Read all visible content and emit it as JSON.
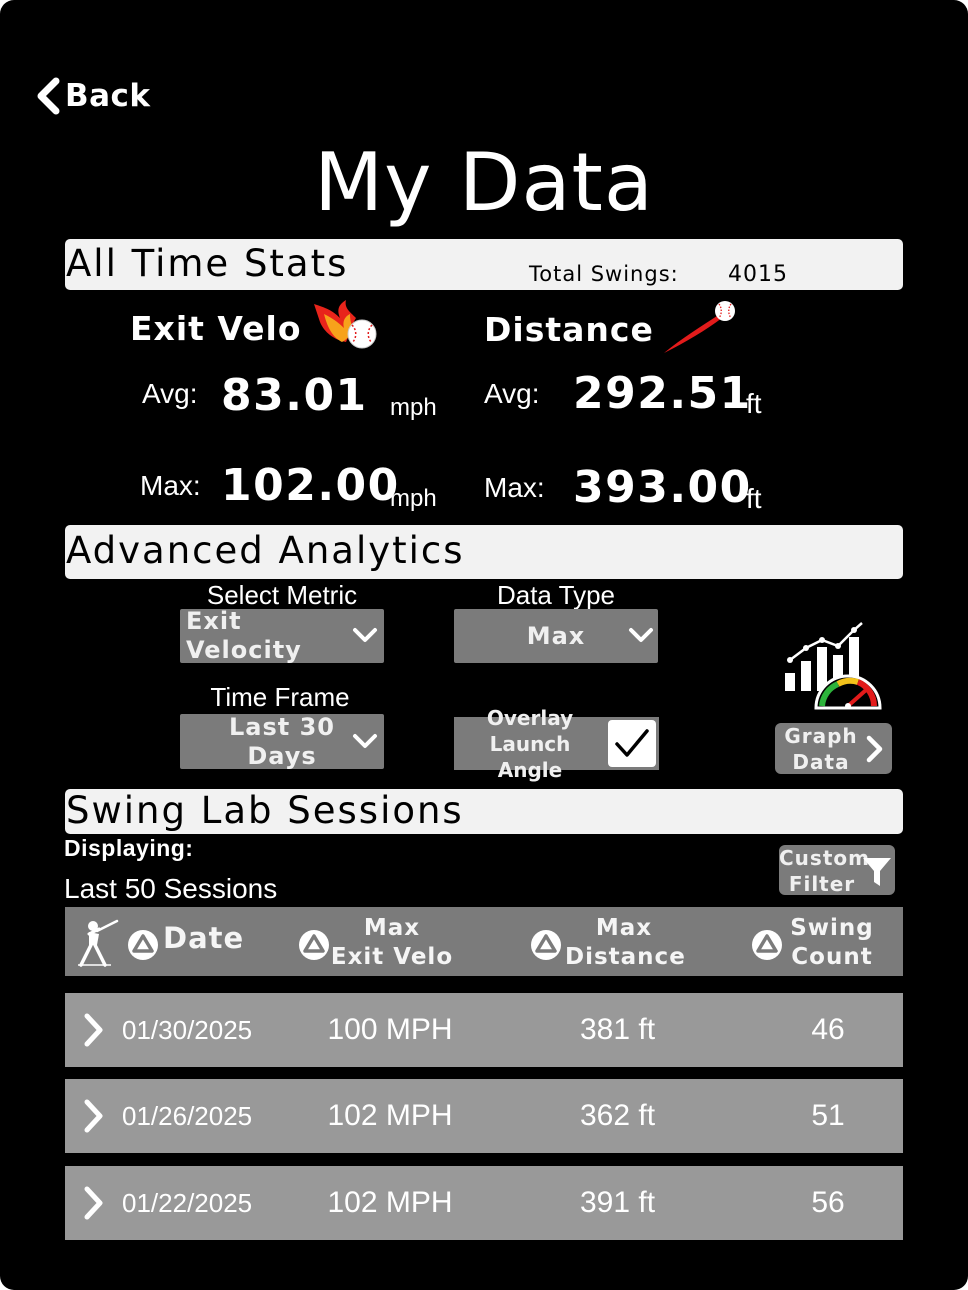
{
  "nav": {
    "back_label": "Back"
  },
  "page": {
    "title": "My Data"
  },
  "all_time": {
    "section_title": "All Time Stats",
    "total_swings_label": "Total Swings:",
    "total_swings_value": "4015",
    "exit_velo": {
      "title": "Exit Velo",
      "avg_label": "Avg:",
      "avg_value": "83.01",
      "max_label": "Max:",
      "max_value": "102.00",
      "unit": "mph",
      "icon": "flaming-baseball-icon"
    },
    "distance": {
      "title": "Distance",
      "avg_label": "Avg:",
      "avg_value": "292.51",
      "max_label": "Max:",
      "max_value": "393.00",
      "unit": "ft",
      "icon": "baseball-trajectory-icon"
    }
  },
  "analytics": {
    "section_title": "Advanced Analytics",
    "metric": {
      "label": "Select Metric",
      "value": "Exit Velocity"
    },
    "data_type": {
      "label": "Data Type",
      "value": "Max"
    },
    "time_frame": {
      "label": "Time Frame",
      "value_line1": "Last 30",
      "value_line2": "Days"
    },
    "overlay": {
      "line1": "Overlay",
      "line2": "Launch Angle",
      "checked": true
    },
    "graph_button": {
      "line1": "Graph",
      "line2": "Data"
    },
    "graph_icon": "chart-gauge-icon"
  },
  "sessions": {
    "section_title": "Swing Lab Sessions",
    "displaying_label": "Displaying:",
    "displaying_value": "Last 50 Sessions",
    "filter_button": {
      "line1": "Custom",
      "line2": "Filter"
    },
    "columns": {
      "date": "Date",
      "velo_line1": "Max",
      "velo_line2": "Exit Velo",
      "dist_line1": "Max",
      "dist_line2": "Distance",
      "count_line1": "Swing",
      "count_line2": "Count"
    },
    "rows": [
      {
        "date": "01/30/2025",
        "velo": "100 MPH",
        "dist": "381 ft",
        "count": "46"
      },
      {
        "date": "01/26/2025",
        "velo": "102 MPH",
        "dist": "362 ft",
        "count": "51"
      },
      {
        "date": "01/22/2025",
        "velo": "102 MPH",
        "dist": "391 ft",
        "count": "56"
      }
    ]
  },
  "colors": {
    "background": "#000000",
    "bar": "#f2f2f2",
    "control_grey": "#7b7b7b",
    "row_grey": "#999999",
    "accent_red": "#e21b1b"
  }
}
